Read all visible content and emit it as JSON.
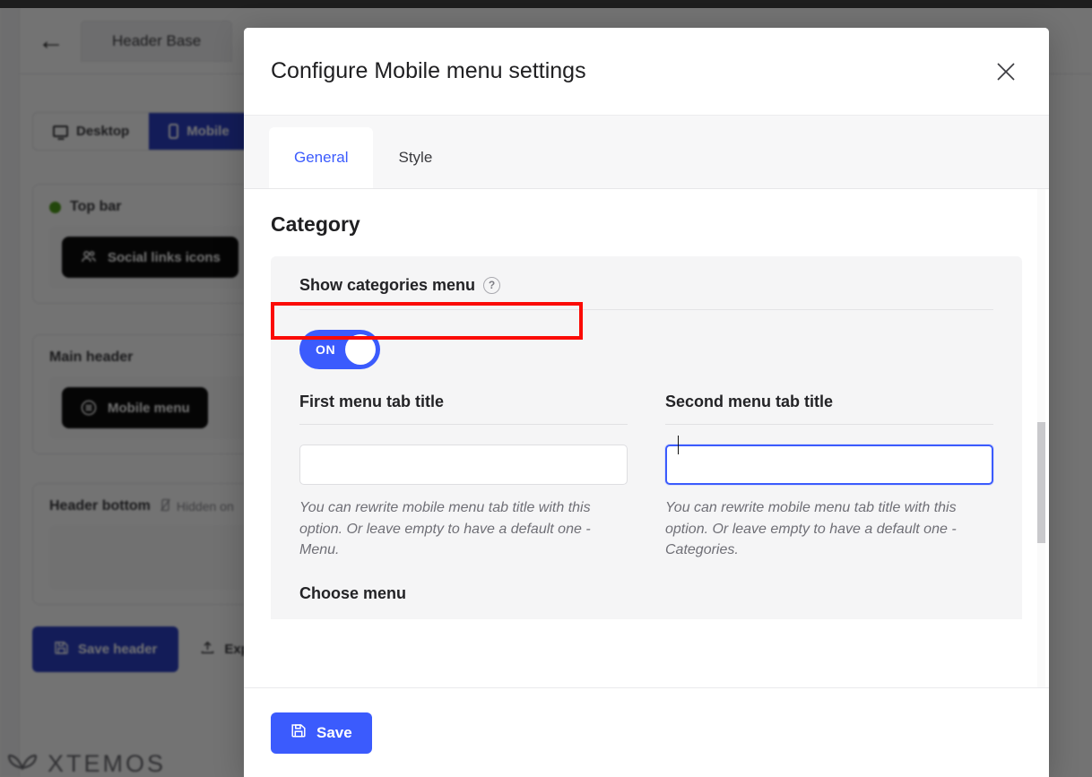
{
  "background": {
    "back_arrow": "←",
    "header_chip_label": "Header Base",
    "device_tabs": [
      {
        "label": "Desktop",
        "icon": "monitor-icon",
        "active": false
      },
      {
        "label": "Mobile",
        "icon": "phone-icon",
        "active": true
      }
    ],
    "sections": [
      {
        "title": "Top bar",
        "has_status_dot": true,
        "status_dot_color": "#4f9d1c",
        "items": [
          {
            "label": "Social links icons",
            "icon": "users-icon"
          }
        ]
      },
      {
        "title": "Main header",
        "has_status_dot": false,
        "items": [
          {
            "label": "Mobile menu",
            "icon": "menu-circle-icon"
          }
        ]
      },
      {
        "title": "Header bottom",
        "has_status_dot": false,
        "note": "Hidden on",
        "note_icon": "hidden-icon",
        "items": []
      }
    ],
    "buttons": [
      {
        "label": "Save header",
        "icon": "floppy-icon",
        "style": "primary"
      },
      {
        "label": "Exp",
        "icon": "upload-icon",
        "style": "ghost"
      }
    ],
    "logo_text": "XTEMOS"
  },
  "modal": {
    "title": "Configure Mobile menu settings",
    "close_icon": "close-icon",
    "tabs": [
      {
        "label": "General",
        "active": true
      },
      {
        "label": "Style",
        "active": false
      }
    ],
    "section_title": "Category",
    "toggle_field": {
      "label": "Show categories menu",
      "help_icon": "help-icon",
      "help_glyph": "?",
      "toggle_state": "ON",
      "toggle_color": "#3b5bfd"
    },
    "fields": [
      {
        "label": "First menu tab title",
        "value": "",
        "placeholder": "",
        "focused": false,
        "hint": "You can rewrite mobile menu tab title with this option. Or leave empty to have a default one - Menu."
      },
      {
        "label": "Second menu tab title",
        "value": "",
        "placeholder": "",
        "focused": true,
        "hint": "You can rewrite mobile menu tab title with this option. Or leave empty to have a default one - Categories."
      }
    ],
    "next_field_label": "Choose menu",
    "footer": {
      "save_label": "Save",
      "save_icon": "floppy-icon",
      "save_color": "#3b5bfd"
    }
  },
  "annotation": {
    "color": "#fb0b06",
    "target": "Show categories menu"
  }
}
